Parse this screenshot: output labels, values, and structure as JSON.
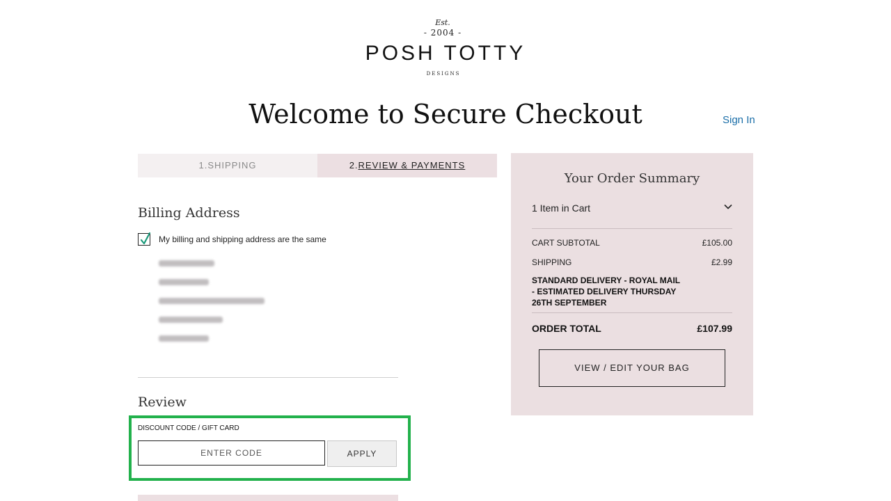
{
  "logo": {
    "est": "Est.",
    "year": "- 2004 -",
    "name": "POSH TOTTY",
    "sub": "DESIGNS"
  },
  "page_title": "Welcome to Secure Checkout",
  "sign_in": "Sign In",
  "steps": [
    {
      "num": "1.",
      "label": "SHIPPING"
    },
    {
      "num": "2.",
      "label": "REVIEW & PAYMENTS"
    }
  ],
  "billing": {
    "title": "Billing Address",
    "same_label": "My billing and shipping address are the same",
    "same_checked": true,
    "address_blurred": true
  },
  "review": {
    "title": "Review",
    "discount_label": "DISCOUNT CODE / GIFT CARD",
    "code_placeholder": "ENTER CODE",
    "apply_label": "APPLY"
  },
  "summary": {
    "title": "Your Order Summary",
    "items_in_cart": "1 Item in Cart",
    "subtotal_label": "CART SUBTOTAL",
    "subtotal_value": "£105.00",
    "shipping_label": "SHIPPING",
    "shipping_value": "£2.99",
    "delivery_line1": "STANDARD DELIVERY - ROYAL MAIL",
    "delivery_line2": "- ESTIMATED DELIVERY THURSDAY",
    "delivery_line3": "26TH SEPTEMBER",
    "total_label": "ORDER TOTAL",
    "total_value": "£107.99",
    "view_bag": "VIEW / EDIT YOUR BAG"
  },
  "colors": {
    "accent_link": "#1a6ea8",
    "panel_bg": "#ebdfe1",
    "highlight": "#22b14c",
    "check": "#1a9a7a"
  }
}
